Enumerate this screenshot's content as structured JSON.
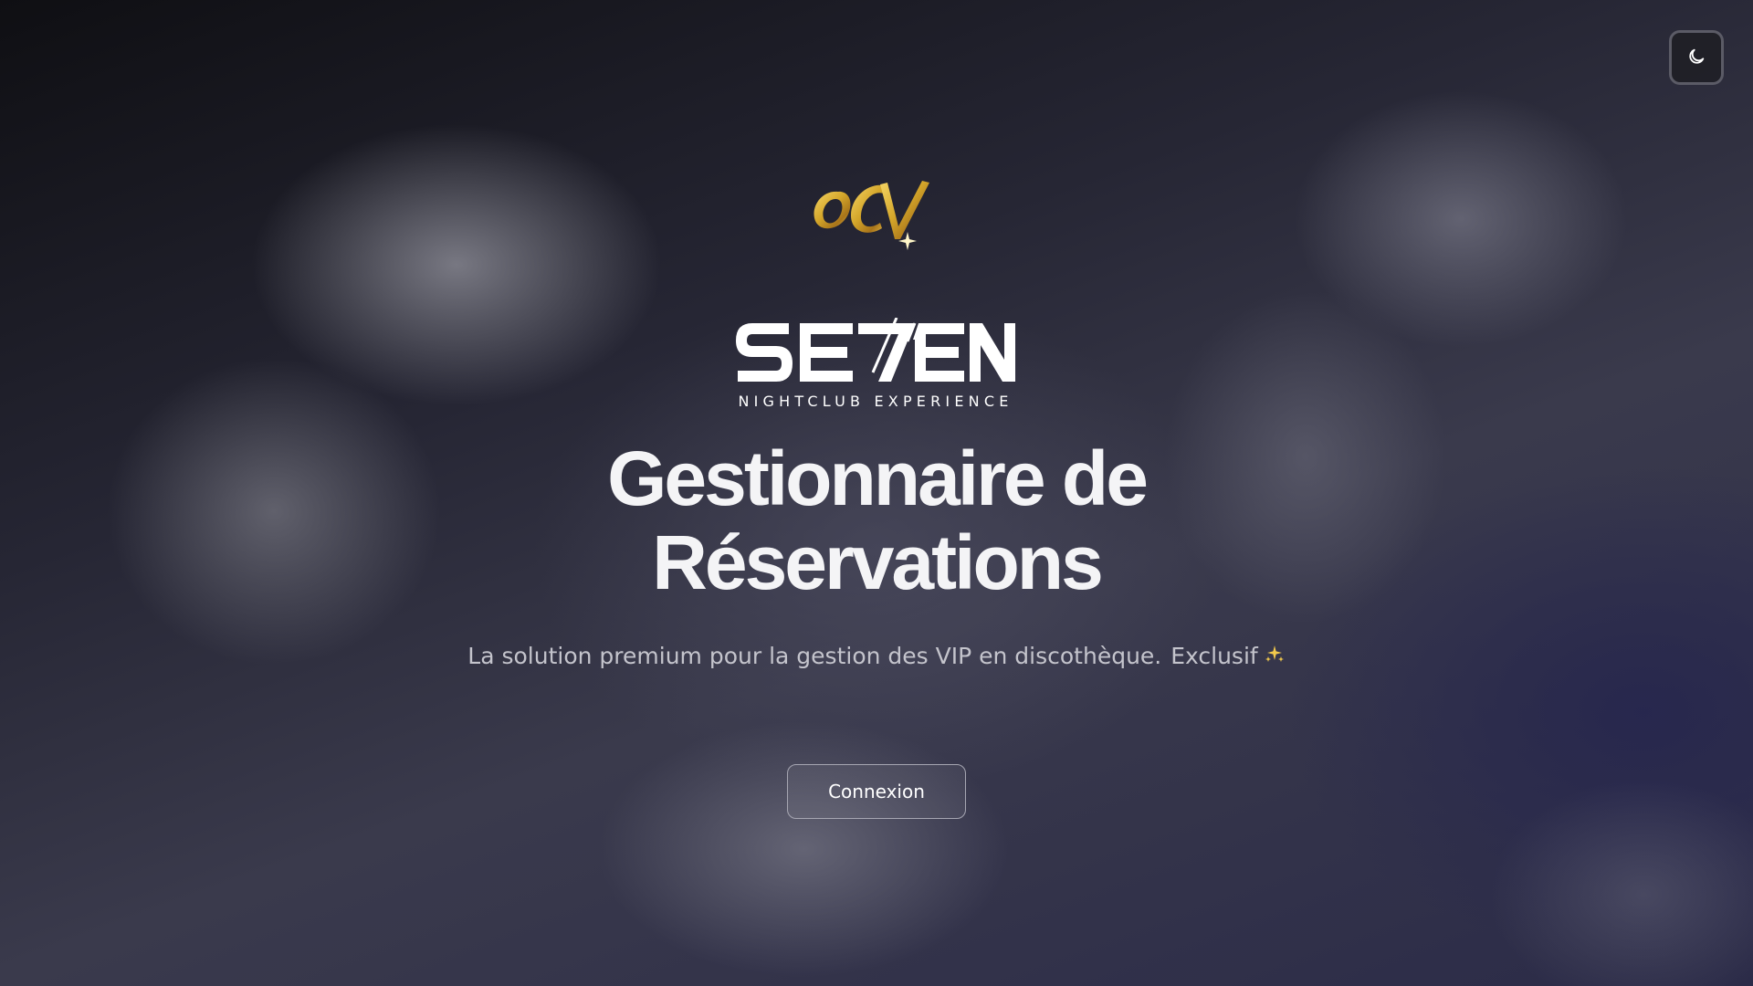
{
  "header": {
    "theme_toggle_icon": "moon-icon"
  },
  "logos": {
    "partner_text": "OCV",
    "brand_name": "SEVEN",
    "brand_tagline": "NIGHTCLUB EXPERIENCE"
  },
  "hero": {
    "title_line_1": "Gestionnaire de",
    "title_line_2": "Réservations",
    "subtitle": "La solution premium pour la gestion des VIP en discothèque.",
    "subtitle_badge": "Exclusif",
    "subtitle_badge_icon": "sparkles-icon",
    "login_label": "Connexion"
  },
  "colors": {
    "gold": "#d4a62a",
    "text": "#ffffff",
    "muted_text": "#c4c4cc"
  }
}
